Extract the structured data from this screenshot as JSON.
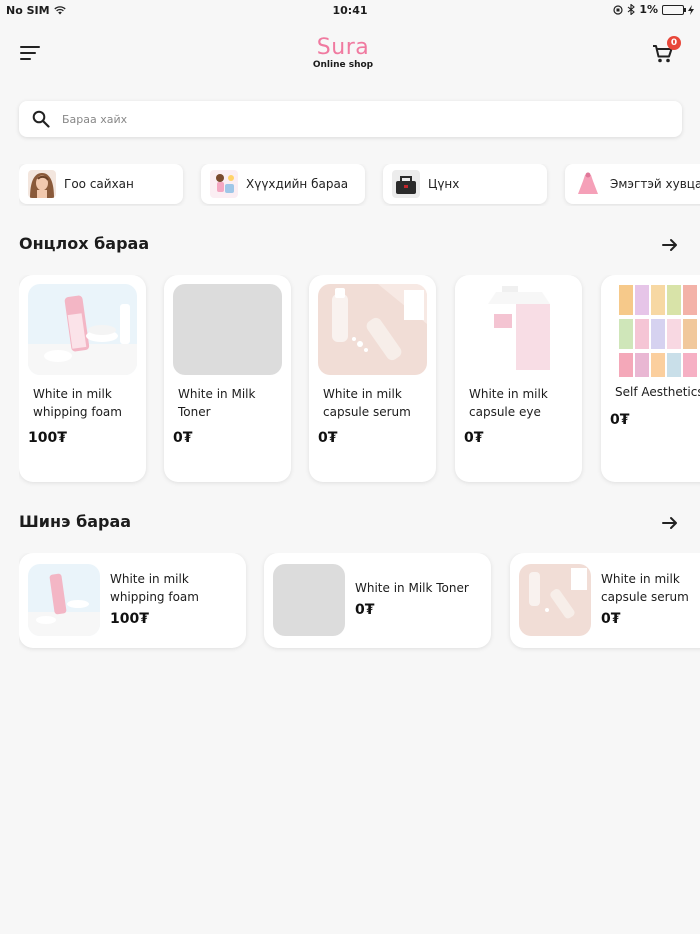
{
  "status_bar": {
    "carrier": "No SIM",
    "time": "10:41",
    "battery": "1%"
  },
  "header": {
    "brand": "Sura",
    "tagline": "Online shop",
    "cart_count": "0",
    "brand_color": "#f07aa0"
  },
  "search": {
    "placeholder": "Бараа хайх",
    "value": ""
  },
  "categories": [
    {
      "label": "Гоо сайхан",
      "icon": "beauty-model-thumb"
    },
    {
      "label": "Хүүхдийн бараа",
      "icon": "kids-goods-thumb"
    },
    {
      "label": "Цүнх",
      "icon": "bag-thumb"
    },
    {
      "label": "Эмэгтэй хувцас",
      "icon": "women-clothing-thumb"
    }
  ],
  "featured": {
    "title": "Онцлох бараа",
    "items": [
      {
        "name": "White in milk whipping foam",
        "price": "100₮"
      },
      {
        "name": "White in Milk Toner",
        "price": "0₮"
      },
      {
        "name": "White in milk capsule serum",
        "price": "0₮"
      },
      {
        "name": "White in milk capsule eye",
        "price": "0₮"
      },
      {
        "name": "Self Aesthetics",
        "price": "0₮"
      }
    ]
  },
  "new_items": {
    "title": "Шинэ бараа",
    "items": [
      {
        "name": "White in milk whipping foam",
        "price": "100₮"
      },
      {
        "name": "White in Milk Toner",
        "price": "0₮"
      },
      {
        "name": "White in milk capsule serum",
        "price": "0₮"
      }
    ]
  },
  "colors": {
    "background": "#f7f7f7",
    "badge": "#e8473a",
    "placeholder_image": "#dcdcdc"
  }
}
